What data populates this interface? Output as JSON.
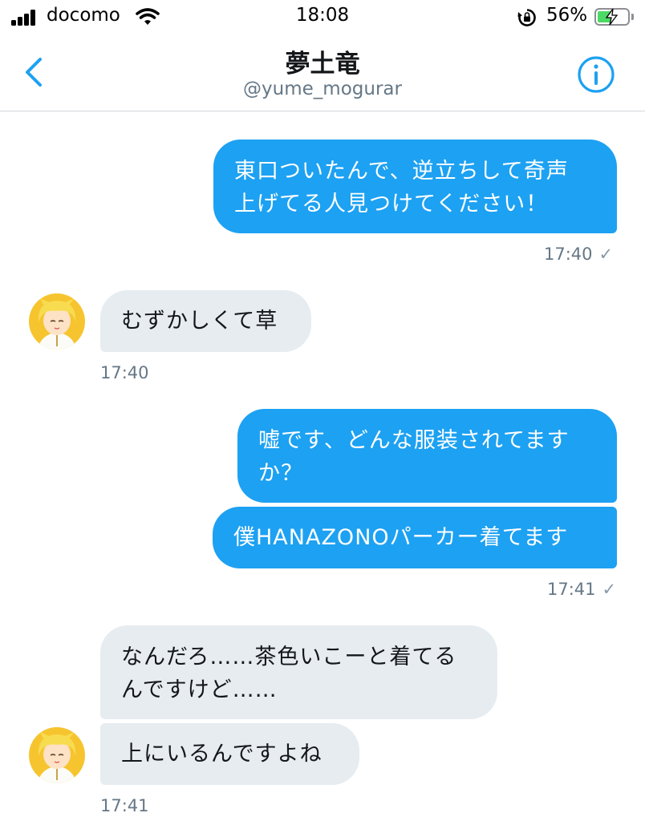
{
  "status_bar": {
    "carrier": "docomo",
    "time": "18:08",
    "battery_percent": "56%",
    "battery_level": 0.56,
    "icons": [
      "signal-icon",
      "wifi-icon",
      "orientation-lock-icon",
      "battery-charging-icon"
    ]
  },
  "header": {
    "title": "夢土竜",
    "handle": "@yume_mogurar",
    "back_icon": "chevron-left-icon",
    "info_icon": "info-icon",
    "accent_color": "#1da1f2"
  },
  "messages": [
    {
      "direction": "sent",
      "text_lines": [
        "東口ついたんで、逆立ちして奇声",
        "上げてる人見つけてください！"
      ]
    },
    {
      "direction": "sent_time",
      "time": "17:40",
      "check": "✓"
    },
    {
      "direction": "received",
      "text_lines": [
        "むずかしくて草"
      ]
    },
    {
      "direction": "received_time",
      "time": "17:40"
    },
    {
      "direction": "sent",
      "text_lines": [
        "嘘です、どんな服装されてます",
        "か？"
      ]
    },
    {
      "direction": "sent",
      "text_lines": [
        "僕HANAZONOパーカー着てます"
      ]
    },
    {
      "direction": "sent_time",
      "time": "17:41",
      "check": "✓"
    },
    {
      "direction": "received",
      "text_lines": [
        "なんだろ……茶色いこーと着てる",
        "んですけど……"
      ]
    },
    {
      "direction": "received",
      "text_lines": [
        "上にいるんですよね"
      ]
    },
    {
      "direction": "received_time",
      "time": "17:41"
    }
  ],
  "colors": {
    "sent_bubble": "#1da1f2",
    "received_bubble": "#e6ecf0",
    "timestamp": "#657786"
  }
}
